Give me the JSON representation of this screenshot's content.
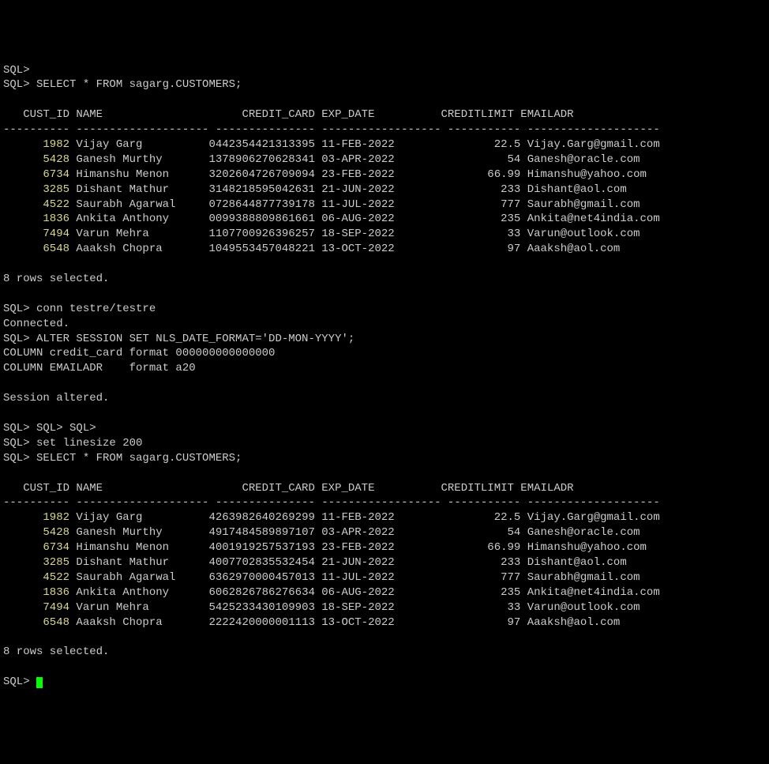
{
  "prompt_partial": "SQL>",
  "line1": "SQL> SELECT * FROM sagarg.CUSTOMERS;",
  "header_line": "   CUST_ID NAME                     CREDIT_CARD EXP_DATE          CREDITLIMIT EMAILADR",
  "separator_line": "---------- -------------------- --------------- ------------------ ----------- --------------------",
  "query1_rows": [
    {
      "id": "1982",
      "name": "Vijay Garg",
      "card": "0442354421313395",
      "date": "11-FEB-2022",
      "limit": "22.5",
      "email": "Vijay.Garg@gmail.com"
    },
    {
      "id": "5428",
      "name": "Ganesh Murthy",
      "card": "1378906270628341",
      "date": "03-APR-2022",
      "limit": "54",
      "email": "Ganesh@oracle.com"
    },
    {
      "id": "6734",
      "name": "Himanshu Menon",
      "card": "3202604726709094",
      "date": "23-FEB-2022",
      "limit": "66.99",
      "email": "Himanshu@yahoo.com"
    },
    {
      "id": "3285",
      "name": "Dishant Mathur",
      "card": "3148218595042631",
      "date": "21-JUN-2022",
      "limit": "233",
      "email": "Dishant@aol.com"
    },
    {
      "id": "4522",
      "name": "Saurabh Agarwal",
      "card": "0728644877739178",
      "date": "11-JUL-2022",
      "limit": "777",
      "email": "Saurabh@gmail.com"
    },
    {
      "id": "1836",
      "name": "Ankita Anthony",
      "card": "0099388809861661",
      "date": "06-AUG-2022",
      "limit": "235",
      "email": "Ankita@net4india.com"
    },
    {
      "id": "7494",
      "name": "Varun Mehra",
      "card": "1107700926396257",
      "date": "18-SEP-2022",
      "limit": "33",
      "email": "Varun@outlook.com"
    },
    {
      "id": "6548",
      "name": "Aaaksh Chopra",
      "card": "1049553457048221",
      "date": "13-OCT-2022",
      "limit": "97",
      "email": "Aaaksh@aol.com"
    }
  ],
  "rows_selected": "8 rows selected.",
  "conn_line": "SQL> conn testre/testre",
  "connected": "Connected.",
  "alter_session": "SQL> ALTER SESSION SET NLS_DATE_FORMAT='DD-MON-YYYY';",
  "column_credit": "COLUMN credit_card format 000000000000000",
  "column_email": "COLUMN EMAILADR    format a20",
  "session_altered": "Session altered.",
  "sql_triple": "SQL> SQL> SQL>",
  "linesize": "SQL> set linesize 200",
  "line2": "SQL> SELECT * FROM sagarg.CUSTOMERS;",
  "query2_rows": [
    {
      "id": "1982",
      "name": "Vijay Garg",
      "card": "4263982640269299",
      "date": "11-FEB-2022",
      "limit": "22.5",
      "email": "Vijay.Garg@gmail.com"
    },
    {
      "id": "5428",
      "name": "Ganesh Murthy",
      "card": "4917484589897107",
      "date": "03-APR-2022",
      "limit": "54",
      "email": "Ganesh@oracle.com"
    },
    {
      "id": "6734",
      "name": "Himanshu Menon",
      "card": "4001919257537193",
      "date": "23-FEB-2022",
      "limit": "66.99",
      "email": "Himanshu@yahoo.com"
    },
    {
      "id": "3285",
      "name": "Dishant Mathur",
      "card": "4007702835532454",
      "date": "21-JUN-2022",
      "limit": "233",
      "email": "Dishant@aol.com"
    },
    {
      "id": "4522",
      "name": "Saurabh Agarwal",
      "card": "6362970000457013",
      "date": "11-JUL-2022",
      "limit": "777",
      "email": "Saurabh@gmail.com"
    },
    {
      "id": "1836",
      "name": "Ankita Anthony",
      "card": "6062826786276634",
      "date": "06-AUG-2022",
      "limit": "235",
      "email": "Ankita@net4india.com"
    },
    {
      "id": "7494",
      "name": "Varun Mehra",
      "card": "5425233430109903",
      "date": "18-SEP-2022",
      "limit": "33",
      "email": "Varun@outlook.com"
    },
    {
      "id": "6548",
      "name": "Aaaksh Chopra",
      "card": "2222420000001113",
      "date": "13-OCT-2022",
      "limit": "97",
      "email": "Aaaksh@aol.com"
    }
  ],
  "final_prompt": "SQL> "
}
